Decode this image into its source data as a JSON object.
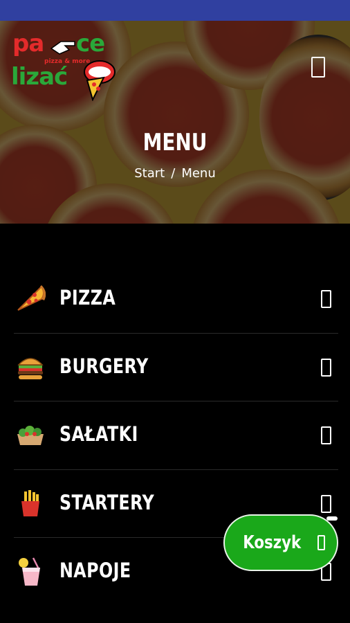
{
  "colors": {
    "status_bar": "#3040a0",
    "cart_button": "#1aa81a",
    "logo_red": "#e42b2b",
    "logo_green": "#2aa83a"
  },
  "logo": {
    "line1_left": "pa",
    "line1_right": "ce",
    "line2": "lizać",
    "tagline": "pizza & more"
  },
  "hero": {
    "title": "MENU",
    "breadcrumb": {
      "start": "Start",
      "separator": "/",
      "current": "Menu"
    }
  },
  "menu_button": {
    "icon": "hamburger-icon"
  },
  "categories": [
    {
      "label": "PIZZA",
      "icon": "pizza-slice-icon"
    },
    {
      "label": "BURGERY",
      "icon": "burger-icon"
    },
    {
      "label": "SAŁATKI",
      "icon": "salad-icon"
    },
    {
      "label": "STARTERY",
      "icon": "fries-icon"
    },
    {
      "label": "NAPOJE",
      "icon": "drink-icon"
    }
  ],
  "cart": {
    "label": "Koszyk",
    "icon": "cart-icon"
  }
}
